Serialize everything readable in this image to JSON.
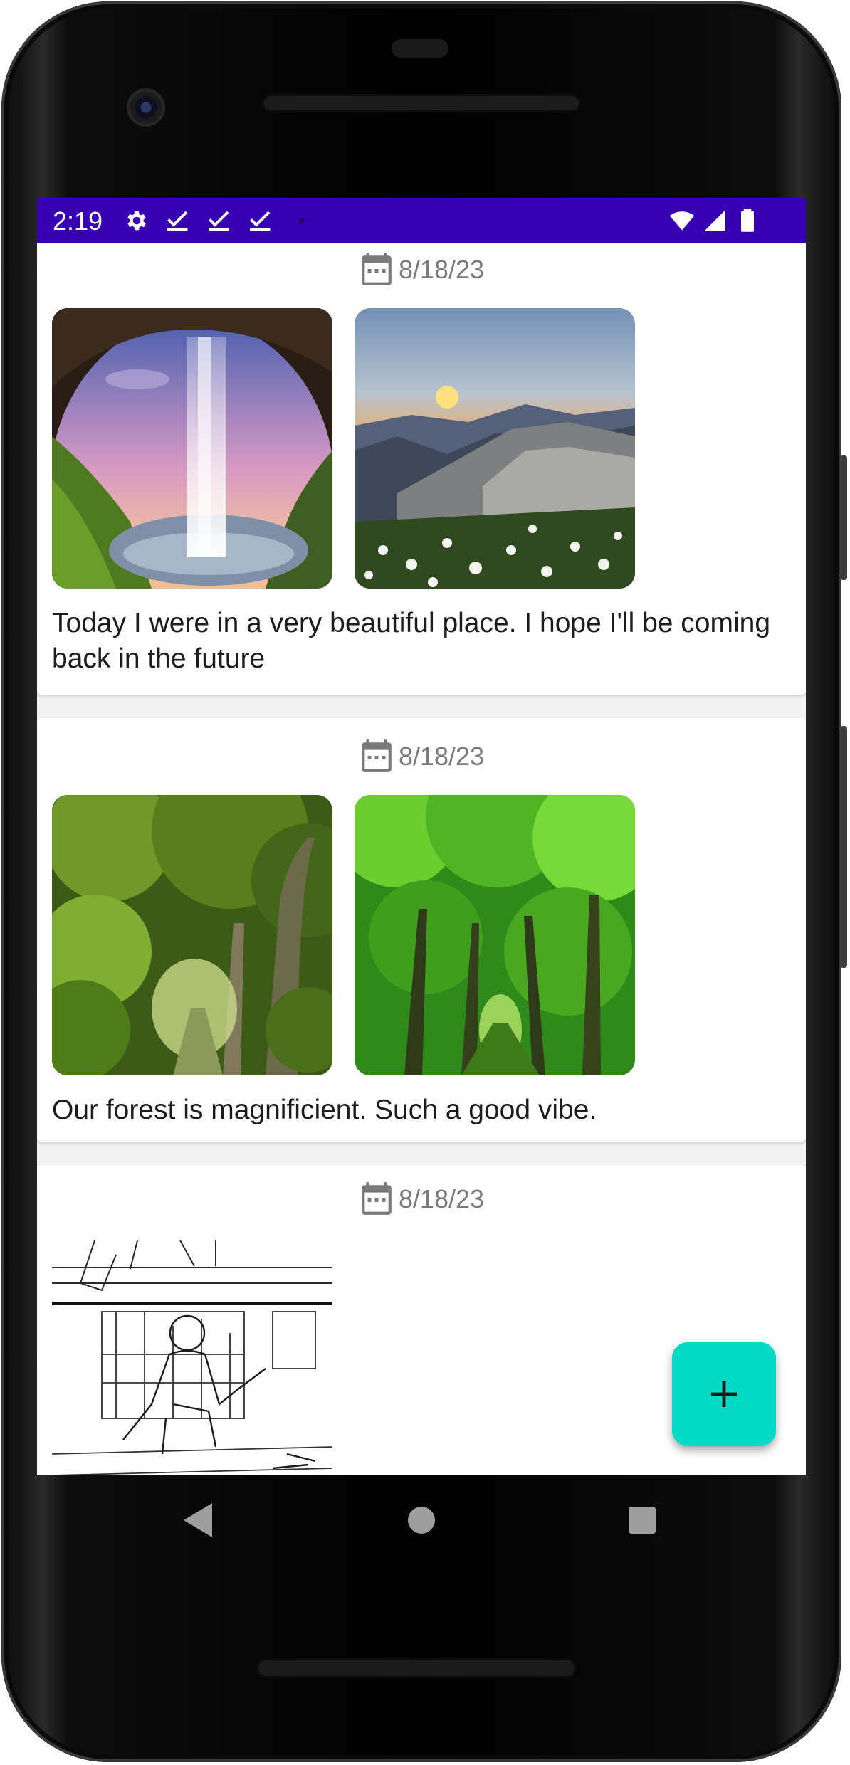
{
  "status_bar": {
    "time": "2:19",
    "color": "#3700b3",
    "left_icons": [
      "settings-icon",
      "check-icon",
      "check-icon",
      "check-icon",
      "dot-icon"
    ],
    "right_icons": [
      "wifi-icon",
      "cell-signal-icon",
      "battery-icon"
    ]
  },
  "feed": {
    "posts": [
      {
        "date": "8/18/23",
        "photos": [
          "waterfall-cave-photo",
          "mountain-sunset-photo"
        ],
        "text": "Today I were in a very beautiful place. I hope I'll be coming back in the future"
      },
      {
        "date": "8/18/23",
        "photos": [
          "forest-path-photo",
          "green-forest-photo"
        ],
        "text": "Our forest is magnificient. Such a good vibe."
      },
      {
        "date": "8/18/23",
        "photos": [
          "storyboard-sketch-photo"
        ],
        "text": ""
      }
    ]
  },
  "fab": {
    "icon": "plus-icon",
    "color": "#03dac5"
  },
  "nav_bar": {
    "icons": [
      "back-icon",
      "home-icon",
      "recents-icon"
    ]
  }
}
